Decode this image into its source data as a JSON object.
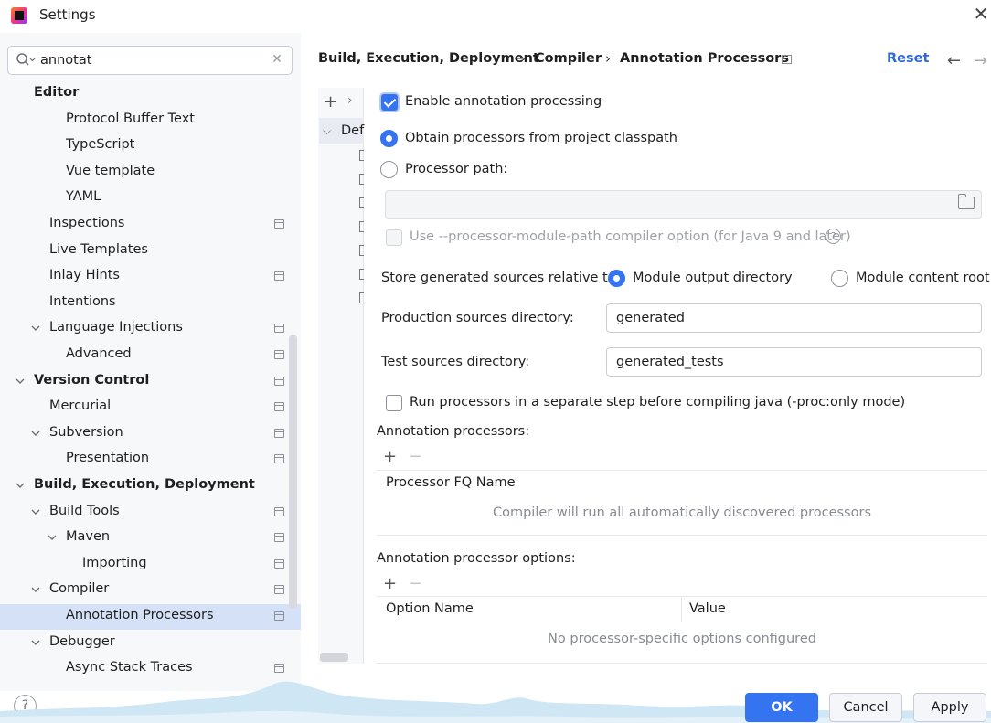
{
  "window": {
    "title": "Settings"
  },
  "search": {
    "value": "annotat"
  },
  "tree": [
    {
      "label": "Editor",
      "bold": true,
      "expanded": null,
      "icon": false,
      "selected": false
    },
    {
      "label": "Protocol Buffer Text",
      "bold": false,
      "expanded": null,
      "icon": false,
      "selected": false
    },
    {
      "label": "TypeScript",
      "bold": false,
      "expanded": null,
      "icon": false,
      "selected": false
    },
    {
      "label": "Vue template",
      "bold": false,
      "expanded": null,
      "icon": false,
      "selected": false
    },
    {
      "label": "YAML",
      "bold": false,
      "expanded": null,
      "icon": false,
      "selected": false
    },
    {
      "label": "Inspections",
      "bold": false,
      "expanded": null,
      "icon": true,
      "selected": false
    },
    {
      "label": "Live Templates",
      "bold": false,
      "expanded": null,
      "icon": false,
      "selected": false
    },
    {
      "label": "Inlay Hints",
      "bold": false,
      "expanded": null,
      "icon": true,
      "selected": false
    },
    {
      "label": "Intentions",
      "bold": false,
      "expanded": null,
      "icon": false,
      "selected": false
    },
    {
      "label": "Language Injections",
      "bold": false,
      "expanded": true,
      "icon": true,
      "selected": false
    },
    {
      "label": "Advanced",
      "bold": false,
      "expanded": null,
      "icon": true,
      "selected": false
    },
    {
      "label": "Version Control",
      "bold": true,
      "expanded": true,
      "icon": true,
      "selected": false
    },
    {
      "label": "Mercurial",
      "bold": false,
      "expanded": null,
      "icon": true,
      "selected": false
    },
    {
      "label": "Subversion",
      "bold": false,
      "expanded": true,
      "icon": true,
      "selected": false
    },
    {
      "label": "Presentation",
      "bold": false,
      "expanded": null,
      "icon": true,
      "selected": false
    },
    {
      "label": "Build, Execution, Deployment",
      "bold": true,
      "expanded": true,
      "icon": false,
      "selected": false
    },
    {
      "label": "Build Tools",
      "bold": false,
      "expanded": true,
      "icon": true,
      "selected": false
    },
    {
      "label": "Maven",
      "bold": false,
      "expanded": true,
      "icon": true,
      "selected": false
    },
    {
      "label": "Importing",
      "bold": false,
      "expanded": null,
      "icon": true,
      "selected": false
    },
    {
      "label": "Compiler",
      "bold": false,
      "expanded": true,
      "icon": true,
      "selected": false
    },
    {
      "label": "Annotation Processors",
      "bold": false,
      "expanded": null,
      "icon": true,
      "selected": true
    },
    {
      "label": "Debugger",
      "bold": false,
      "expanded": true,
      "icon": false,
      "selected": false
    },
    {
      "label": "Async Stack Traces",
      "bold": false,
      "expanded": null,
      "icon": true,
      "selected": false
    }
  ],
  "breadcrumb": {
    "items": [
      "Build, Execution, Deployment",
      "Compiler",
      "Annotation Processors"
    ],
    "separator": "›",
    "reset": "Reset"
  },
  "profiles": {
    "default_label": "Def"
  },
  "form": {
    "enable_annotation_processing": {
      "label": "Enable annotation processing",
      "checked": true
    },
    "obtain_from_classpath": {
      "label": "Obtain processors from project classpath",
      "selected": true
    },
    "processor_path": {
      "label": "Processor path:",
      "selected": false,
      "value": ""
    },
    "module_path_option": {
      "label": "Use --processor-module-path compiler option (for Java 9 and later)",
      "enabled": false,
      "help": "?"
    },
    "store_generated": {
      "label": "Store generated sources relative to:",
      "options": [
        "Module output directory",
        "Module content root"
      ],
      "selected": "Module output directory"
    },
    "production_sources": {
      "label": "Production sources directory:",
      "value": "generated"
    },
    "test_sources": {
      "label": "Test sources directory:",
      "value": "generated_tests"
    },
    "run_separate_step": {
      "label": "Run processors in a separate step before compiling java (-proc:only mode)",
      "checked": false
    }
  },
  "annotation_processors": {
    "title": "Annotation processors:",
    "add": "+",
    "remove": "−",
    "column": "Processor FQ Name",
    "empty": "Compiler will run all automatically discovered processors"
  },
  "processor_options": {
    "title": "Annotation processor options:",
    "add": "+",
    "remove": "−",
    "columns": [
      "Option Name",
      "Value"
    ],
    "empty": "No processor-specific options configured"
  },
  "footer": {
    "help": "?",
    "ok": "OK",
    "cancel": "Cancel",
    "apply": "Apply"
  },
  "colors": {
    "accent": "#3574f0",
    "selection": "#d5e1f7",
    "link": "#2f68d6"
  }
}
